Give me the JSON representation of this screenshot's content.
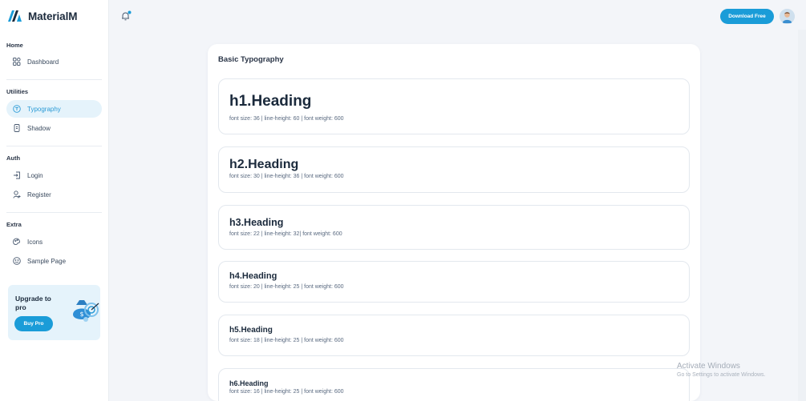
{
  "app": {
    "name": "MaterialM",
    "accent_color": "#1a9cd8"
  },
  "sidebar": {
    "sections": [
      {
        "title": "Home",
        "items": [
          {
            "label": "Dashboard",
            "icon": "dashboard-icon"
          }
        ]
      },
      {
        "title": "Utilities",
        "items": [
          {
            "label": "Typography",
            "icon": "typography-icon",
            "active": true
          },
          {
            "label": "Shadow",
            "icon": "shadow-icon"
          }
        ]
      },
      {
        "title": "Auth",
        "items": [
          {
            "label": "Login",
            "icon": "login-icon"
          },
          {
            "label": "Register",
            "icon": "register-icon"
          }
        ]
      },
      {
        "title": "Extra",
        "items": [
          {
            "label": "Icons",
            "icon": "icons-icon"
          },
          {
            "label": "Sample Page",
            "icon": "sample-page-icon"
          }
        ]
      }
    ],
    "upgrade": {
      "title": "Upgrade to pro",
      "button": "Buy Pro"
    }
  },
  "topbar": {
    "download_button": "Download Free"
  },
  "main": {
    "card_title": "Basic Typography",
    "headings": [
      {
        "text": "h1.Heading",
        "meta": "font size: 36 | line-height: 60 | font weight: 600"
      },
      {
        "text": "h2.Heading",
        "meta": "font size: 30 | line-height: 36 | font weight: 600"
      },
      {
        "text": "h3.Heading",
        "meta": "font size: 22 | line-height: 32| font weight: 600"
      },
      {
        "text": "h4.Heading",
        "meta": "font size: 20 | line-height: 25 | font weight: 600"
      },
      {
        "text": "h5.Heading",
        "meta": "font size: 18 | line-height: 25 | font weight: 600"
      },
      {
        "text": "h6.Heading",
        "meta": "font size: 16 | line-height: 25 | font weight: 600"
      }
    ]
  },
  "watermark": {
    "title": "Activate Windows",
    "subtitle": "Go to Settings to activate Windows."
  }
}
